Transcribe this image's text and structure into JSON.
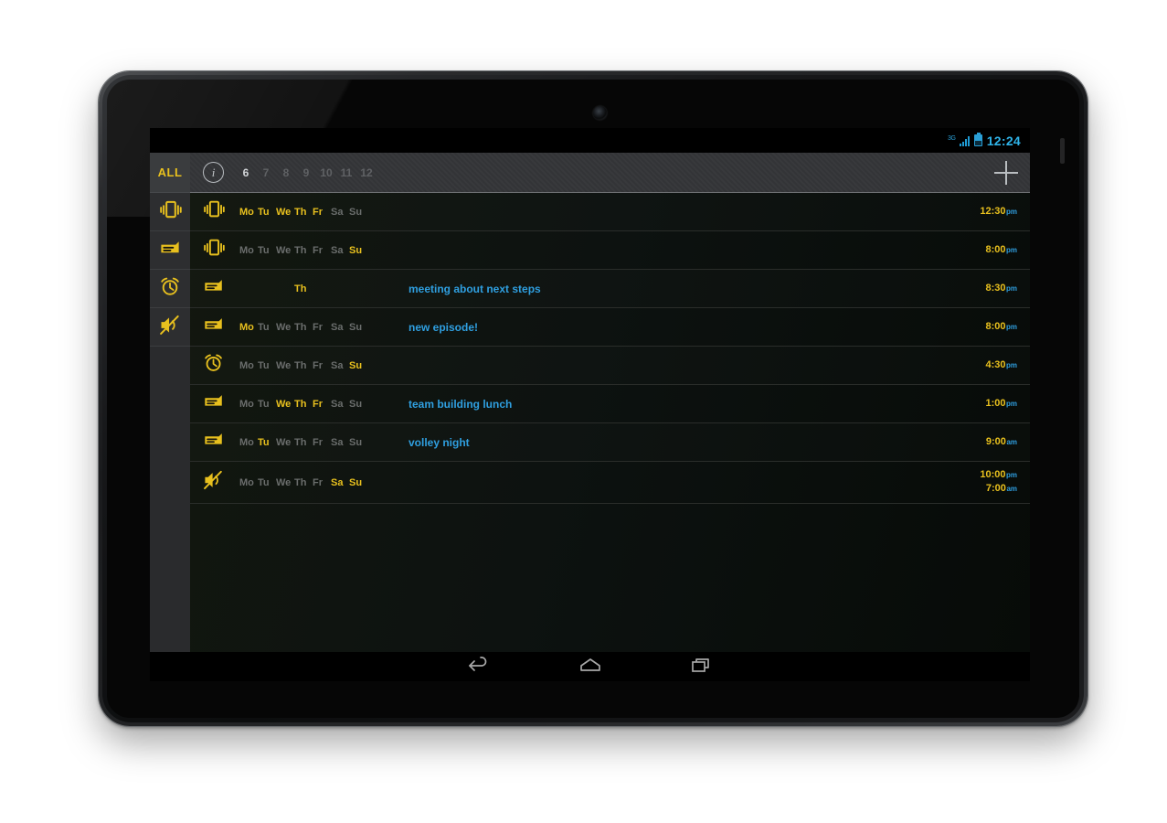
{
  "device": {
    "name": "android-tablet"
  },
  "statusbar": {
    "network_label": "3G",
    "signal_icon": "signal-bars-icon",
    "battery_icon": "battery-icon",
    "clock": "12:24"
  },
  "sidebar": {
    "all_label": "ALL",
    "filters": [
      {
        "icon": "vibrate-icon",
        "name": "filter-vibrate"
      },
      {
        "icon": "note-card-icon",
        "name": "filter-note"
      },
      {
        "icon": "alarm-clock-icon",
        "name": "filter-alarm"
      },
      {
        "icon": "mute-icon",
        "name": "filter-mute"
      }
    ]
  },
  "header": {
    "info_icon": "info-icon",
    "info_label": "i",
    "hours": [
      {
        "label": "6",
        "active": true
      },
      {
        "label": "7",
        "active": false
      },
      {
        "label": "8",
        "active": false
      },
      {
        "label": "9",
        "active": false
      },
      {
        "label": "10",
        "active": false
      },
      {
        "label": "11",
        "active": false
      },
      {
        "label": "12",
        "active": false
      }
    ],
    "add_label": "+",
    "add_icon": "plus-icon"
  },
  "day_names": [
    "Mo",
    "Tu",
    "We",
    "Th",
    "Fr",
    "Sa",
    "Su"
  ],
  "rows": [
    {
      "icon": "vibrate-icon",
      "days_on": [
        "Mo",
        "Tu",
        "We",
        "Th",
        "Fr"
      ],
      "days_visible": true,
      "title": "",
      "times": [
        {
          "time": "12:30",
          "mer": "pm"
        }
      ]
    },
    {
      "icon": "vibrate-icon",
      "days_on": [
        "Su"
      ],
      "days_visible": true,
      "title": "",
      "times": [
        {
          "time": "8:00",
          "mer": "pm"
        }
      ]
    },
    {
      "icon": "note-card-icon",
      "days_on": [
        "Th"
      ],
      "days_visible": false,
      "title": "meeting about next steps",
      "times": [
        {
          "time": "8:30",
          "mer": "pm"
        }
      ]
    },
    {
      "icon": "note-card-icon",
      "days_on": [
        "Mo"
      ],
      "days_visible": true,
      "title": "new episode!",
      "times": [
        {
          "time": "8:00",
          "mer": "pm"
        }
      ]
    },
    {
      "icon": "alarm-clock-icon",
      "days_on": [
        "Su"
      ],
      "days_visible": true,
      "title": "",
      "times": [
        {
          "time": "4:30",
          "mer": "pm"
        }
      ]
    },
    {
      "icon": "note-card-icon",
      "days_on": [
        "We",
        "Th",
        "Fr"
      ],
      "days_visible": true,
      "title": "team building lunch",
      "times": [
        {
          "time": "1:00",
          "mer": "pm"
        }
      ]
    },
    {
      "icon": "note-card-icon",
      "days_on": [
        "Tu"
      ],
      "days_visible": true,
      "title": "volley night",
      "times": [
        {
          "time": "9:00",
          "mer": "am"
        }
      ]
    },
    {
      "icon": "mute-icon",
      "days_on": [
        "Sa",
        "Su"
      ],
      "days_visible": true,
      "title": "",
      "times": [
        {
          "time": "10:00",
          "mer": "pm"
        },
        {
          "time": "7:00",
          "mer": "am"
        }
      ]
    }
  ],
  "navbar": {
    "back_icon": "back-arrow-icon",
    "home_icon": "home-icon",
    "recents_icon": "recents-icon"
  },
  "colors": {
    "accent_yellow": "#e8c01e",
    "accent_blue": "#2f9fe0",
    "status_blue": "#2fb3e8",
    "day_off": "#6a6d6c",
    "sidebar_bg": "#2d2e30",
    "header_bg": "#333437",
    "list_bg": "#0d1210"
  }
}
